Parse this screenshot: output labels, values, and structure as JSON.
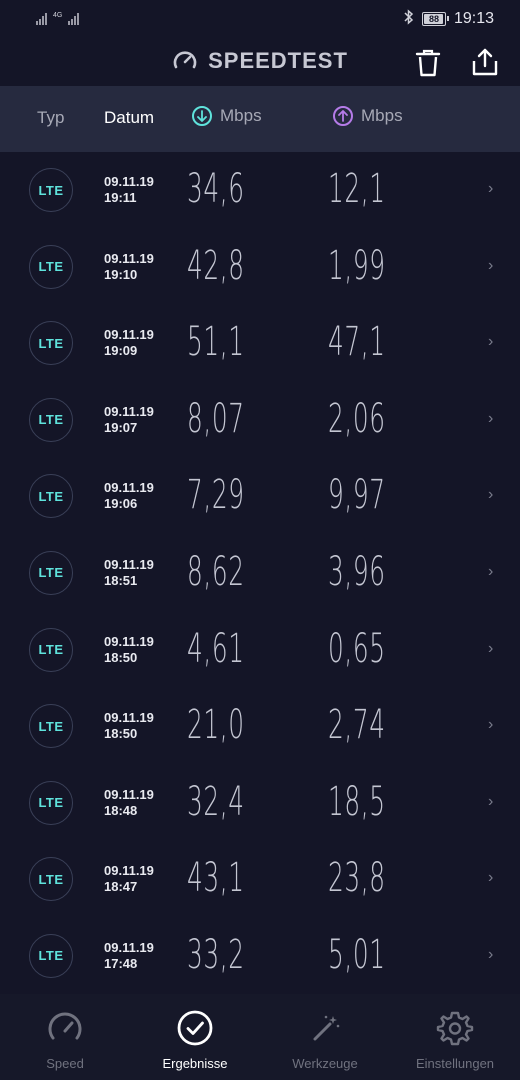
{
  "status": {
    "network": "4G",
    "battery": "88",
    "time": "19:13"
  },
  "app": {
    "title": "SPEEDTEST"
  },
  "header": {
    "type_label": "Typ",
    "date_label": "Datum",
    "download_label": "Mbps",
    "upload_label": "Mbps"
  },
  "results": [
    {
      "type": "LTE",
      "date": "09.11.19",
      "time": "19:11",
      "download": "34,6",
      "upload": "12,1"
    },
    {
      "type": "LTE",
      "date": "09.11.19",
      "time": "19:10",
      "download": "42,8",
      "upload": "1,99"
    },
    {
      "type": "LTE",
      "date": "09.11.19",
      "time": "19:09",
      "download": "51,1",
      "upload": "47,1"
    },
    {
      "type": "LTE",
      "date": "09.11.19",
      "time": "19:07",
      "download": "8,07",
      "upload": "2,06"
    },
    {
      "type": "LTE",
      "date": "09.11.19",
      "time": "19:06",
      "download": "7,29",
      "upload": "9,97"
    },
    {
      "type": "LTE",
      "date": "09.11.19",
      "time": "18:51",
      "download": "8,62",
      "upload": "3,96"
    },
    {
      "type": "LTE",
      "date": "09.11.19",
      "time": "18:50",
      "download": "4,61",
      "upload": "0,65"
    },
    {
      "type": "LTE",
      "date": "09.11.19",
      "time": "18:50",
      "download": "21,0",
      "upload": "2,74"
    },
    {
      "type": "LTE",
      "date": "09.11.19",
      "time": "18:48",
      "download": "32,4",
      "upload": "18,5"
    },
    {
      "type": "LTE",
      "date": "09.11.19",
      "time": "18:47",
      "download": "43,1",
      "upload": "23,8"
    },
    {
      "type": "LTE",
      "date": "09.11.19",
      "time": "17:48",
      "download": "33,2",
      "upload": "5,01"
    }
  ],
  "nav": [
    {
      "label": "Speed",
      "icon": "gauge-icon",
      "active": false
    },
    {
      "label": "Ergebnisse",
      "icon": "check-circle-icon",
      "active": true
    },
    {
      "label": "Werkzeuge",
      "icon": "magic-wand-icon",
      "active": false
    },
    {
      "label": "Einstellungen",
      "icon": "gear-icon",
      "active": false
    }
  ],
  "colors": {
    "background": "#141527",
    "header_bg": "#262a3f",
    "download_accent": "#5fe3dc",
    "upload_accent": "#b57be8"
  }
}
